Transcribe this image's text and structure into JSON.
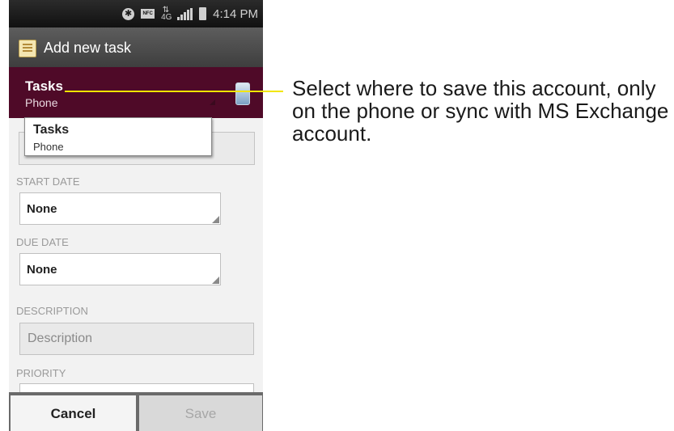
{
  "status_bar": {
    "time": "4:14 PM",
    "nfc_label": "NFC",
    "network_label": "4G",
    "icons": [
      "bluetooth-icon",
      "nfc-icon",
      "4g-icon",
      "signal-icon",
      "battery-icon"
    ]
  },
  "action_bar": {
    "title": "Add new task",
    "icon": "task-notes-icon"
  },
  "account_selector": {
    "title": "Tasks",
    "subtitle": "Phone",
    "icon": "phone-icon"
  },
  "dropdown": {
    "options": [
      {
        "title": "Tasks",
        "subtitle": "Phone"
      }
    ]
  },
  "form": {
    "start_date": {
      "label": "START DATE",
      "value": "None"
    },
    "due_date": {
      "label": "DUE DATE",
      "value": "None"
    },
    "description": {
      "label": "DESCRIPTION",
      "placeholder": "Description"
    },
    "priority": {
      "label": "PRIORITY"
    }
  },
  "buttons": {
    "cancel": "Cancel",
    "save": "Save"
  },
  "callout": {
    "text": "Select where to save this account, only on the phone or sync with MS Exchange account.",
    "line_color": "#f2e600"
  },
  "colors": {
    "account_bar": "#4f0a28",
    "action_bar": "#4a4a4a"
  }
}
